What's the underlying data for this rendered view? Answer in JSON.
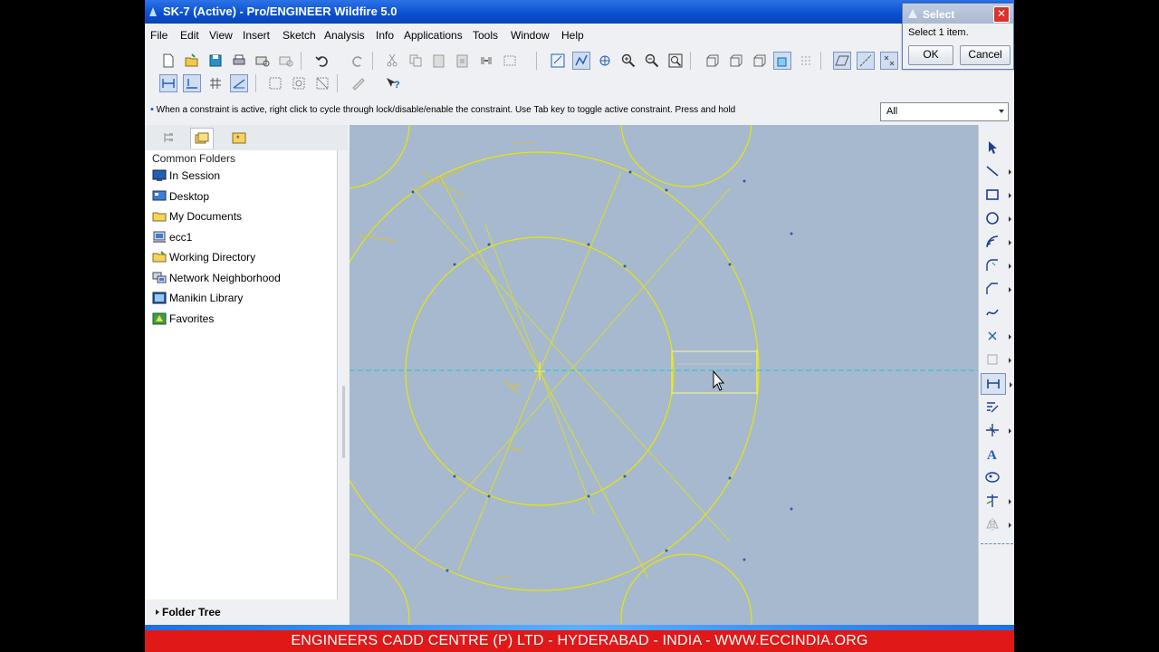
{
  "window": {
    "title": "SK-7 (Active) - Pro/ENGINEER Wildfire 5.0"
  },
  "menu": [
    "File",
    "Edit",
    "View",
    "Insert",
    "Sketch",
    "Analysis",
    "Info",
    "Applications",
    "Tools",
    "Window",
    "Help"
  ],
  "message": "When a constraint is active, right click to cycle through lock/disable/enable the constraint. Use Tab key to toggle active constraint. Press and hold",
  "filter": {
    "value": "All"
  },
  "navigator": {
    "heading": "Common Folders",
    "folders": [
      "In Session",
      "Desktop",
      "My Documents",
      "ecc1",
      "Working Directory",
      "Network Neighborhood",
      "Manikin Library",
      "Favorites"
    ],
    "folder_tree_label": "Folder Tree"
  },
  "select_dialog": {
    "title": "Select",
    "message": "Select 1 item.",
    "ok": "OK",
    "cancel": "Cancel"
  },
  "footer": "ENGINEERS CADD CENTRE (P) LTD - HYDERABAD - INDIA - WWW.ECCINDIA.ORG",
  "colors": {
    "canvas": "#a7b9ce",
    "sketch": "#e8e600",
    "centerline": "#17c8d8",
    "titlebar": "#0a4fd0",
    "footer": "#e01818"
  },
  "icons": {
    "toolbar": [
      "new-file-icon",
      "open-file-icon",
      "save-icon",
      "print-icon",
      "email-icon",
      "email-link-icon",
      "undo-icon",
      "redo-icon",
      "cut-icon",
      "copy-icon",
      "paste-icon",
      "paste-special-icon",
      "regenerate-icon",
      "select-box-icon",
      "sketch-orientation-icon",
      "sketch-display-icon",
      "repaint-icon",
      "zoom-in-icon",
      "zoom-out-icon",
      "refit-icon",
      "view-manager-icon",
      "saved-views-icon",
      "shading-icon",
      "hidden-line-icon",
      "no-hidden-icon",
      "datum-planes-icon",
      "datum-axes-icon",
      "datum-points-icon"
    ],
    "right_toolbar": [
      "select-arrow-icon",
      "line-icon",
      "rectangle-icon",
      "circle-icon",
      "arc-icon",
      "fillet-icon",
      "chamfer-icon",
      "spline-icon",
      "point-icon",
      "offset-icon",
      "dimension-icon",
      "modify-icon",
      "constraint-icon",
      "text-icon",
      "palette-icon",
      "trim-icon",
      "mirror-icon"
    ]
  }
}
